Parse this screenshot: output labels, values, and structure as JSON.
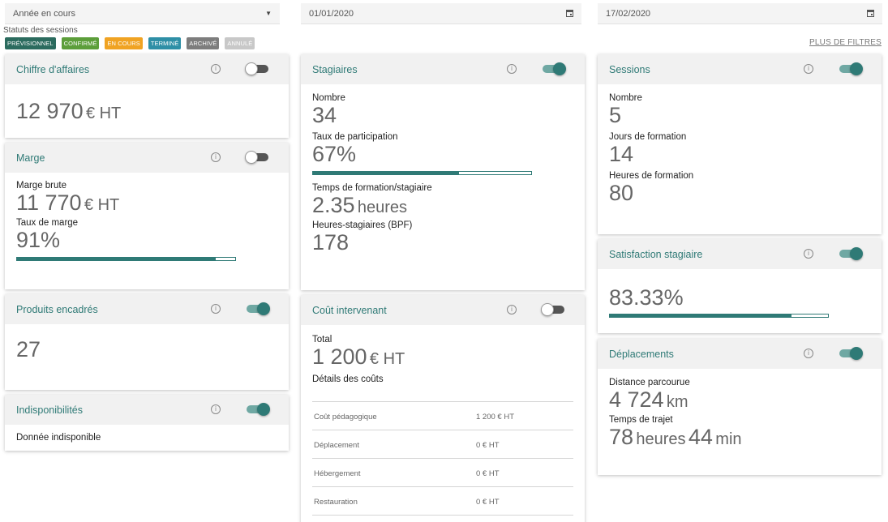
{
  "filters": {
    "period": "Année en cours",
    "start_date": "01/01/2020",
    "end_date": "17/02/2020",
    "statuts_label": "Statuts des sessions",
    "more_filters": "PLUS DE FILTRES"
  },
  "statuses": [
    {
      "label": "PRÉVISIONNEL",
      "color": "#2b6b5e"
    },
    {
      "label": "CONFIRMÉ",
      "color": "#5c9e3a"
    },
    {
      "label": "EN COURS",
      "color": "#f0a323"
    },
    {
      "label": "TERMINÉ",
      "color": "#2e8fa6"
    },
    {
      "label": "ARCHIVÉ",
      "color": "#7d7d7d"
    },
    {
      "label": "ANNULÉ",
      "color": "#c8c8c8"
    }
  ],
  "cards": {
    "ca": {
      "title": "Chiffre d'affaires",
      "enabled": false,
      "value": "12 970",
      "unit": "€ HT"
    },
    "marge": {
      "title": "Marge",
      "enabled": false,
      "brute_label": "Marge brute",
      "brute_value": "11 770",
      "brute_unit": "€ HT",
      "taux_label": "Taux de marge",
      "taux_value": "91%",
      "taux_fraction": 0.91
    },
    "produits": {
      "title": "Produits encadrés",
      "enabled": true,
      "value": "27"
    },
    "indispo": {
      "title": "Indisponibilités",
      "enabled": true,
      "text": "Donnée indisponible"
    },
    "stagiaires": {
      "title": "Stagiaires",
      "enabled": true,
      "nombre_label": "Nombre",
      "nombre_value": "34",
      "taux_label": "Taux de participation",
      "taux_value": "67%",
      "taux_fraction": 0.67,
      "temps_label": "Temps de formation/stagiaire",
      "temps_value": "2.35",
      "temps_unit": "heures",
      "bpf_label": "Heures-stagiaires (BPF)",
      "bpf_value": "178"
    },
    "cout": {
      "title": "Coût intervenant",
      "enabled": false,
      "total_label": "Total",
      "total_value": "1 200",
      "total_unit": "€ HT",
      "details_label": "Détails des coûts",
      "rows": [
        {
          "name": "Coût pédagogique",
          "value": "1 200 € HT"
        },
        {
          "name": "Déplacement",
          "value": "0 € HT"
        },
        {
          "name": "Hébergement",
          "value": "0 € HT"
        },
        {
          "name": "Restauration",
          "value": "0 € HT"
        }
      ]
    },
    "sessions": {
      "title": "Sessions",
      "enabled": true,
      "nombre_label": "Nombre",
      "nombre_value": "5",
      "jours_label": "Jours de formation",
      "jours_value": "14",
      "heures_label": "Heures de formation",
      "heures_value": "80"
    },
    "satisfaction": {
      "title": "Satisfaction stagiaire",
      "enabled": true,
      "value": "83.33%",
      "fraction": 0.8333
    },
    "deplacements": {
      "title": "Déplacements",
      "enabled": true,
      "distance_label": "Distance parcourue",
      "distance_value": "4 724",
      "distance_unit": "km",
      "trajet_label": "Temps de trajet",
      "trajet_hours": "78",
      "trajet_hours_unit": "heures",
      "trajet_min": "44",
      "trajet_min_unit": "min"
    }
  },
  "colors": {
    "accent": "#2f7a76",
    "header_bg": "#f1f1f1"
  }
}
